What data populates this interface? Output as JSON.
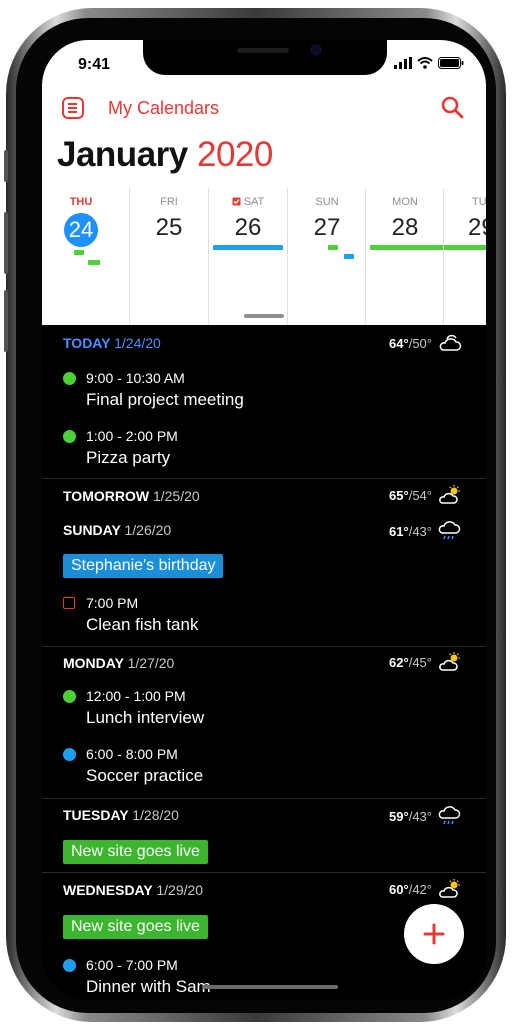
{
  "status_bar": {
    "time": "9:41"
  },
  "header": {
    "calendars_label": "My Calendars",
    "month": "January",
    "year": "2020"
  },
  "week": [
    {
      "dow": "THU",
      "num": "24",
      "today": true
    },
    {
      "dow": "FRI",
      "num": "25"
    },
    {
      "dow": "SAT",
      "num": "26"
    },
    {
      "dow": "SUN",
      "num": "27"
    },
    {
      "dow": "MON",
      "num": "28"
    },
    {
      "dow": "TU",
      "num": "29"
    }
  ],
  "days": [
    {
      "label": "TODAY",
      "date": "1/24/20",
      "high": "64°",
      "low": "/50°",
      "events": [
        {
          "time": "9:00 - 10:30 AM",
          "title": "Final project meeting"
        },
        {
          "time": "1:00 - 2:00 PM",
          "title": "Pizza party"
        }
      ]
    },
    {
      "label": "TOMORROW",
      "date": "1/25/20",
      "high": "65°",
      "low": "/54°"
    },
    {
      "label": "SUNDAY",
      "date": "1/26/20",
      "high": "61°",
      "low": "/43°",
      "allday": "Stephanie's birthday",
      "task": {
        "time": "7:00 PM",
        "title": "Clean fish tank"
      }
    },
    {
      "label": "MONDAY",
      "date": "1/27/20",
      "high": "62°",
      "low": "/45°",
      "events": [
        {
          "time": "12:00 - 1:00 PM",
          "title": "Lunch interview"
        },
        {
          "time": "6:00 - 8:00 PM",
          "title": "Soccer practice"
        }
      ]
    },
    {
      "label": "TUESDAY",
      "date": "1/28/20",
      "high": "59°",
      "low": "/43°",
      "allday": "New site goes live"
    },
    {
      "label": "WEDNESDAY",
      "date": "1/29/20",
      "high": "60°",
      "low": "/42°",
      "allday": "New site goes live",
      "events": [
        {
          "time": "6:00 - 7:00 PM",
          "title": "Dinner with Sam"
        }
      ]
    }
  ],
  "colors": {
    "accent": "#e53935",
    "today_blue": "#1e90ff",
    "green": "#4cd137",
    "blue_event": "#1ea0f0",
    "allday_blue": "#1a8fd8",
    "allday_green": "#3cb52f"
  },
  "icons": [
    "menu-icon",
    "search-icon",
    "signal-icon",
    "wifi-icon",
    "battery-icon",
    "partly-cloudy-icon",
    "sunny-cloudy-icon",
    "rain-cloud-icon",
    "plus-icon"
  ]
}
